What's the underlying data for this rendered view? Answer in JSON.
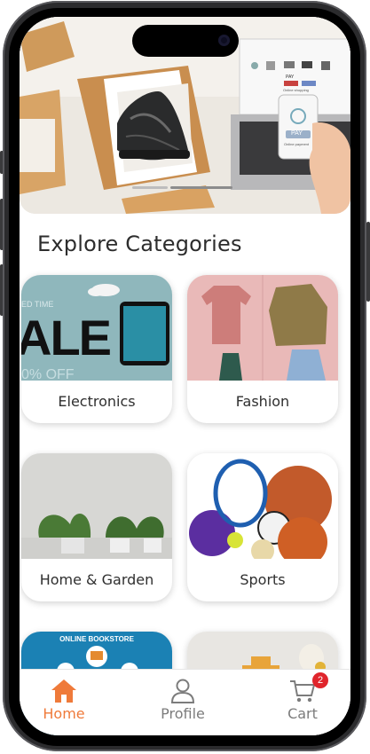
{
  "section_title": "Explore Categories",
  "hero": {
    "laptop_button": "PAY",
    "laptop_text": "Online shopping",
    "phone_button": "PAY",
    "phone_text": "Online payment"
  },
  "categories": [
    {
      "label": "Electronics",
      "banner_text_a": "ED TIME",
      "banner_text_b": "ALE",
      "banner_text_c": "0% OFF"
    },
    {
      "label": "Fashion"
    },
    {
      "label": "Home & Garden"
    },
    {
      "label": "Sports"
    },
    {
      "label": "",
      "banner_text": "ONLINE BOOKSTORE"
    },
    {
      "label": ""
    }
  ],
  "tabbar": {
    "items": [
      {
        "label": "Home",
        "icon": "home-icon",
        "active": true
      },
      {
        "label": "Profile",
        "icon": "profile-icon",
        "active": false
      },
      {
        "label": "Cart",
        "icon": "cart-icon",
        "active": false
      }
    ],
    "cart_badge": "2"
  },
  "colors": {
    "accent": "#ef7a3a",
    "inactive": "#7c7c7c",
    "badge": "#e0252c"
  }
}
